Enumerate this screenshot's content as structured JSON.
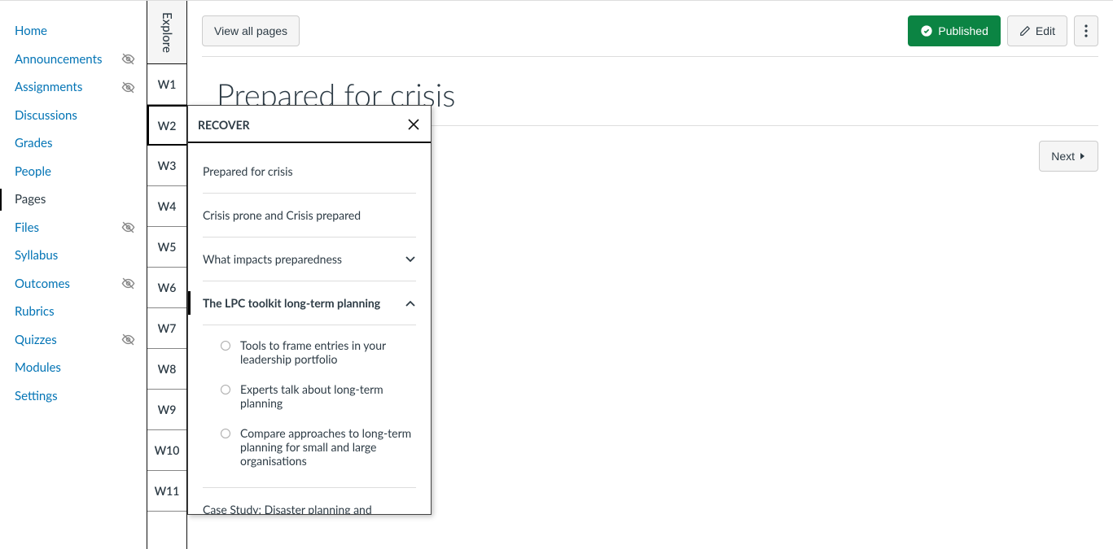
{
  "course_nav": {
    "items": [
      {
        "label": "Home",
        "hidden": false,
        "active": false
      },
      {
        "label": "Announcements",
        "hidden": true,
        "active": false
      },
      {
        "label": "Assignments",
        "hidden": true,
        "active": false
      },
      {
        "label": "Discussions",
        "hidden": false,
        "active": false
      },
      {
        "label": "Grades",
        "hidden": false,
        "active": false
      },
      {
        "label": "People",
        "hidden": false,
        "active": false
      },
      {
        "label": "Pages",
        "hidden": false,
        "active": true
      },
      {
        "label": "Files",
        "hidden": true,
        "active": false
      },
      {
        "label": "Syllabus",
        "hidden": false,
        "active": false
      },
      {
        "label": "Outcomes",
        "hidden": true,
        "active": false
      },
      {
        "label": "Rubrics",
        "hidden": false,
        "active": false
      },
      {
        "label": "Quizzes",
        "hidden": true,
        "active": false
      },
      {
        "label": "Modules",
        "hidden": false,
        "active": false
      },
      {
        "label": "Settings",
        "hidden": false,
        "active": false
      }
    ]
  },
  "weeks": {
    "head": "Explore",
    "items": [
      "W1",
      "W2",
      "W3",
      "W4",
      "W5",
      "W6",
      "W7",
      "W8",
      "W9",
      "W10",
      "W11"
    ],
    "active_index": 1
  },
  "toolbar": {
    "view_all": "View all pages",
    "published": "Published",
    "edit": "Edit"
  },
  "page": {
    "title": "Prepared for crisis"
  },
  "pager": {
    "next": "Next"
  },
  "dropdown": {
    "title": "RECOVER",
    "items": [
      {
        "label": "Prepared for crisis",
        "expandable": false
      },
      {
        "label": "Crisis prone and Crisis prepared",
        "expandable": false
      },
      {
        "label": "What impacts preparedness",
        "expandable": true,
        "expanded": false
      },
      {
        "label": "The LPC toolkit long-term planning",
        "expandable": true,
        "expanded": true
      }
    ],
    "sub_items": [
      "Tools to frame entries in your leadership portfolio",
      "Experts talk about long-term planning",
      "Compare approaches to long-term planning for small and large organisations"
    ],
    "tail_item": "Case Study: Disaster planning and"
  }
}
